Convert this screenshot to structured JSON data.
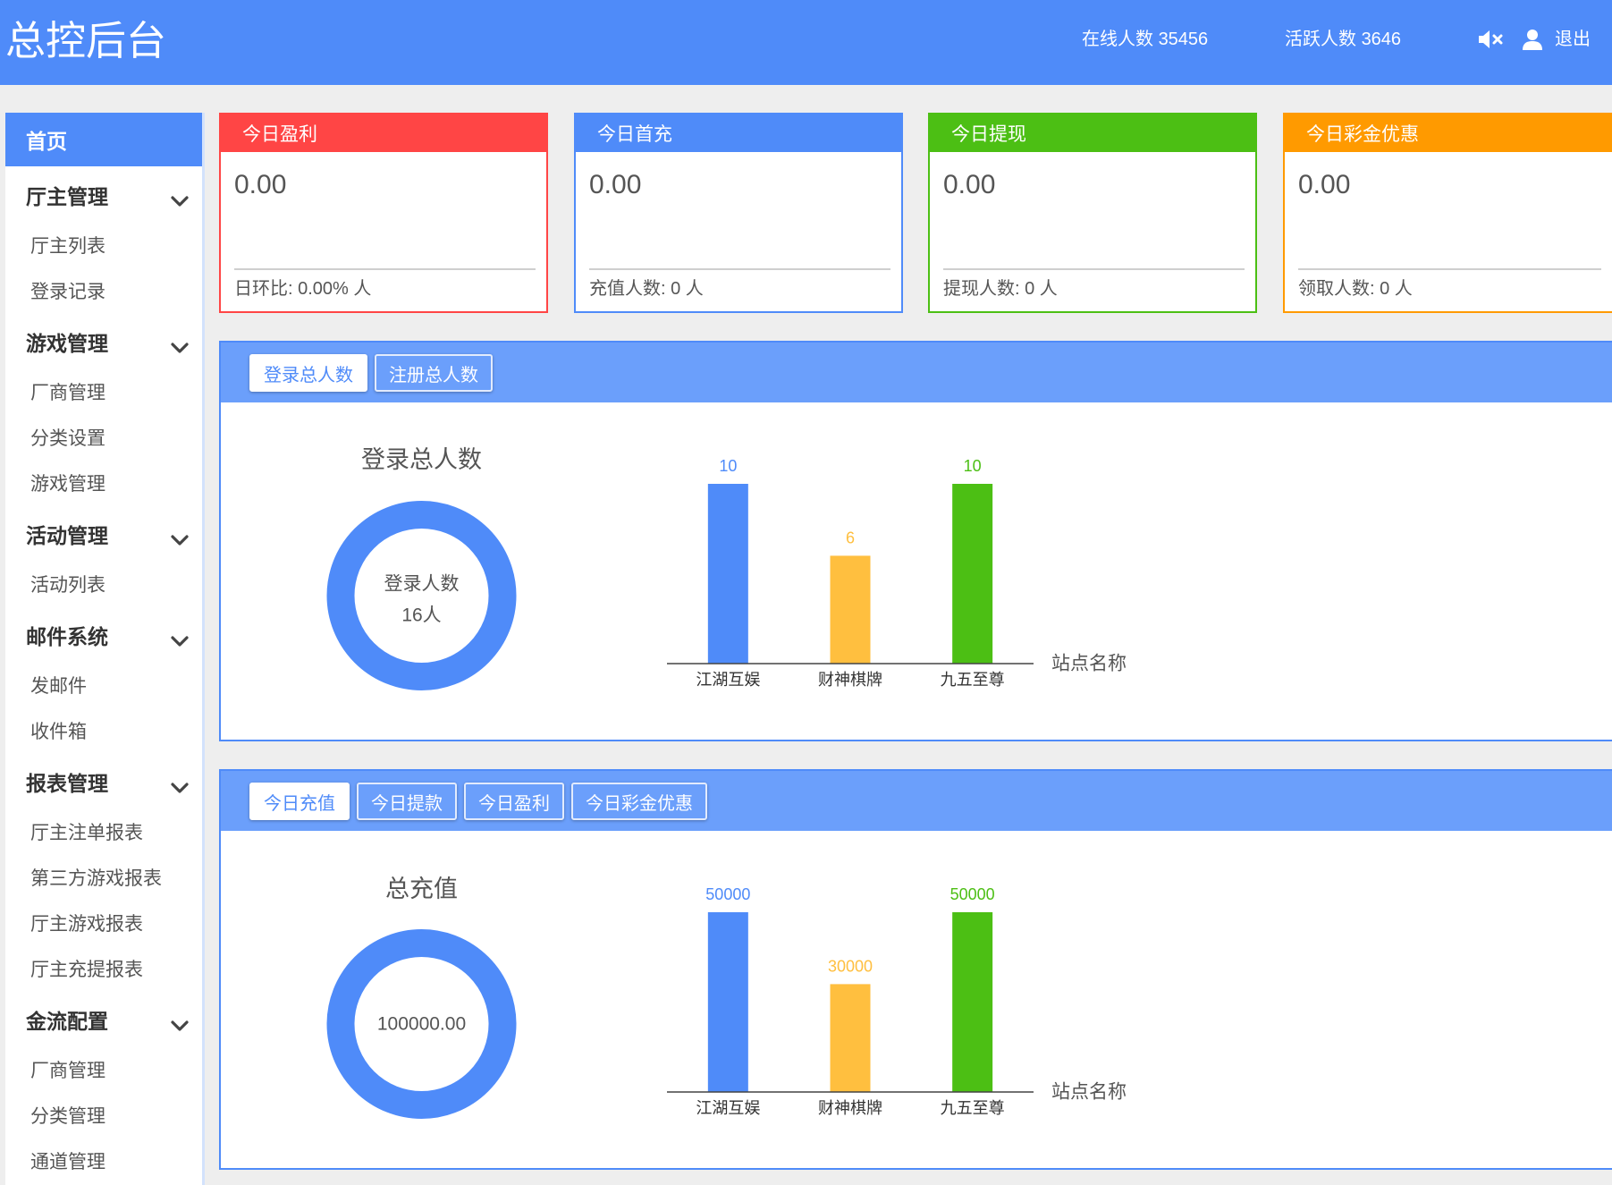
{
  "theme": {
    "primary": "#4f8bf9",
    "panel_header": "#6b9ffb",
    "page_background": "#eeeeee"
  },
  "header": {
    "title": "总控后台",
    "online": {
      "label": "在线人数",
      "value": "35456"
    },
    "active_users": {
      "label": "活跃人数",
      "value": "3646"
    },
    "logout": "退出",
    "icons": {
      "mute": "mute-icon",
      "user": "user-icon"
    }
  },
  "sidebar": {
    "home": {
      "label": "首页",
      "active": true
    },
    "groups": [
      {
        "label": "厅主管理",
        "icon": "chevron-down-icon",
        "expanded": true,
        "items": [
          "厅主列表",
          "登录记录"
        ]
      },
      {
        "label": "游戏管理",
        "icon": "chevron-down-icon",
        "expanded": true,
        "items": [
          "厂商管理",
          "分类设置",
          "游戏管理"
        ]
      },
      {
        "label": "活动管理",
        "icon": "chevron-down-icon",
        "expanded": true,
        "items": [
          "活动列表"
        ]
      },
      {
        "label": "邮件系统",
        "icon": "chevron-down-icon",
        "expanded": true,
        "items": [
          "发邮件",
          "收件箱"
        ]
      },
      {
        "label": "报表管理",
        "icon": "chevron-down-icon",
        "expanded": true,
        "items": [
          "厅主注单报表",
          "第三方游戏报表",
          "厅主游戏报表",
          "厅主充提报表"
        ]
      },
      {
        "label": "金流配置",
        "icon": "chevron-down-icon",
        "expanded": true,
        "items": [
          "厂商管理",
          "分类管理",
          "通道管理"
        ]
      }
    ]
  },
  "stats": [
    {
      "title": "今日盈利",
      "value": "0.00",
      "footer": "日环比: 0.00% 人",
      "color": "#ff4545"
    },
    {
      "title": "今日首充",
      "value": "0.00",
      "footer": "充值人数: 0 人",
      "color": "#4f8bf9"
    },
    {
      "title": "今日提现",
      "value": "0.00",
      "footer": "提现人数: 0 人",
      "color": "#4cbf14"
    },
    {
      "title": "今日彩金优惠",
      "value": "0.00",
      "footer": "领取人数: 0 人",
      "color": "#ff9a00"
    }
  ],
  "panels": [
    {
      "tabs": [
        "登录总人数",
        "注册总人数"
      ],
      "active_tab": 0
    },
    {
      "tabs": [
        "今日充值",
        "今日提款",
        "今日盈利",
        "今日彩金优惠"
      ],
      "active_tab": 0
    }
  ],
  "chart_data": [
    {
      "type": "pie",
      "donut": true,
      "title": "登录总人数",
      "center_label": "登录人数",
      "center_value": "16人",
      "values": [
        16
      ],
      "colors": [
        "#4f8bf9"
      ]
    },
    {
      "type": "bar",
      "categories": [
        "江湖互娱",
        "财神棋牌",
        "九五至尊"
      ],
      "values": [
        10,
        6,
        10
      ],
      "colors": [
        "#4f8bf9",
        "#ffbf3f",
        "#4cbf14"
      ],
      "xlabel": "站点名称",
      "data_labels": true,
      "grid": false
    },
    {
      "type": "pie",
      "donut": true,
      "title": "总充值",
      "center_value": "100000.00",
      "values": [
        100000
      ],
      "colors": [
        "#4f8bf9"
      ]
    },
    {
      "type": "bar",
      "categories": [
        "江湖互娱",
        "财神棋牌",
        "九五至尊"
      ],
      "values": [
        50000,
        30000,
        50000
      ],
      "colors": [
        "#4f8bf9",
        "#ffbf3f",
        "#4cbf14"
      ],
      "xlabel": "站点名称",
      "data_labels": true,
      "grid": false
    }
  ]
}
